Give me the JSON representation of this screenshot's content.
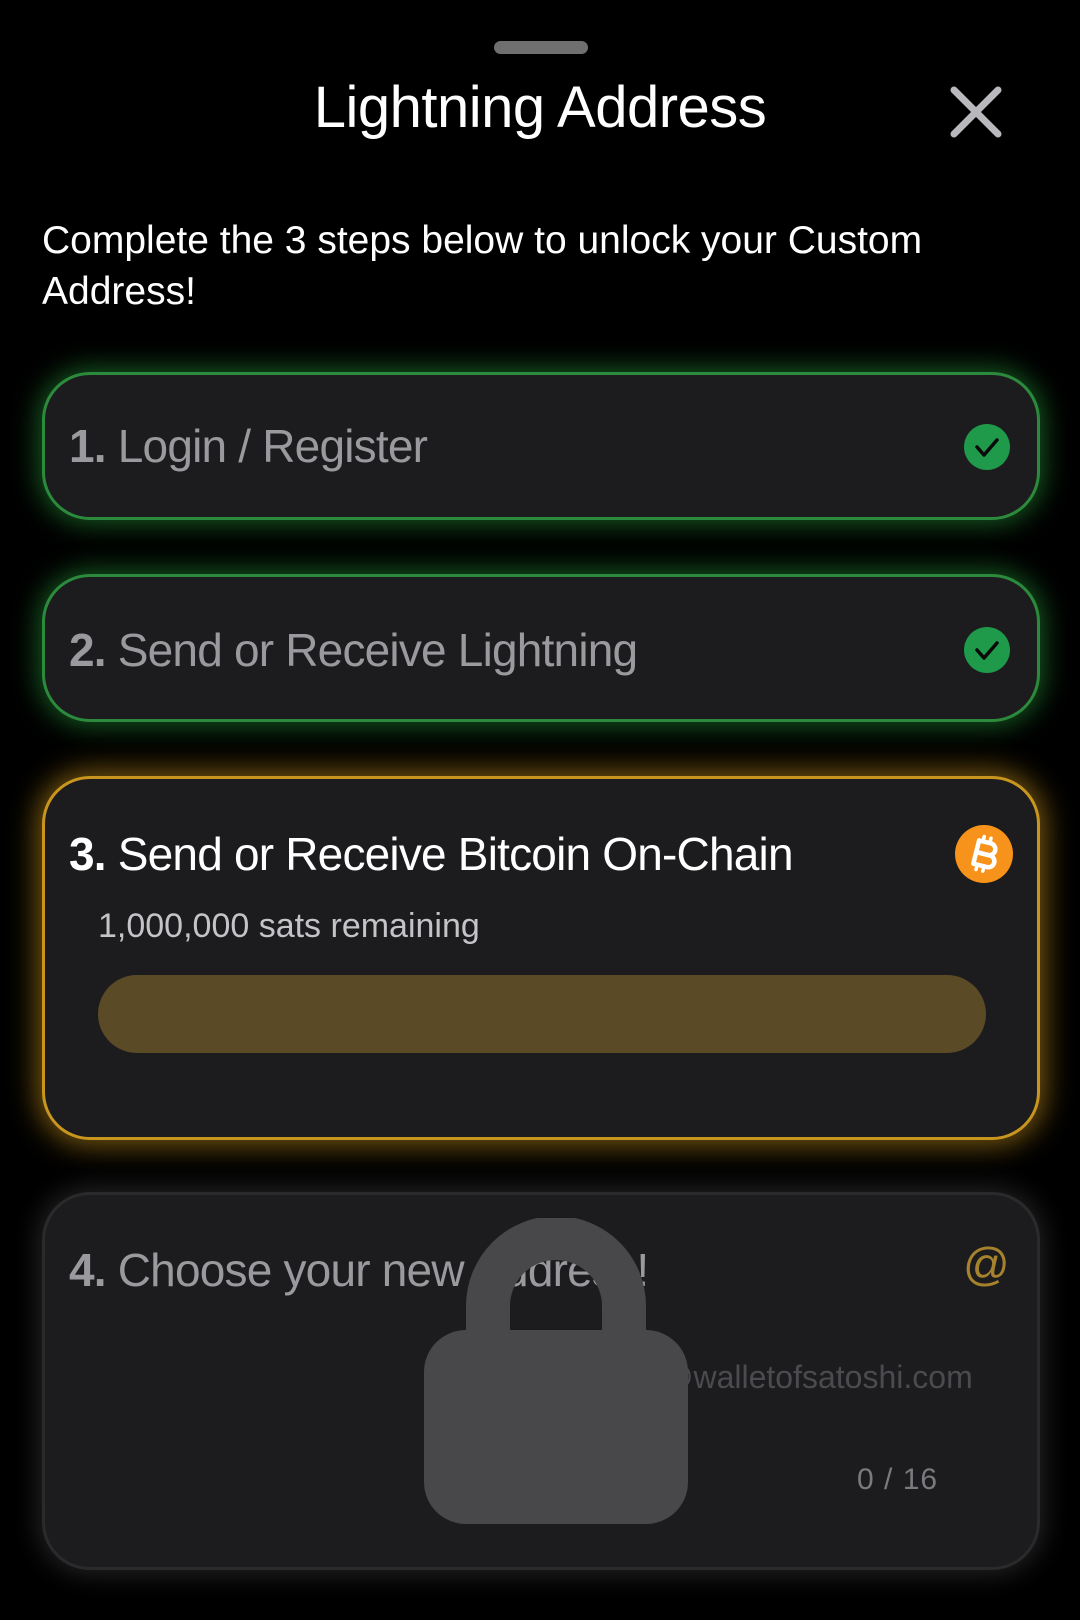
{
  "sheet": {
    "title": "Lightning Address",
    "intro": "Complete the 3 steps below to unlock your Custom Address!"
  },
  "steps": [
    {
      "number": "1.",
      "label": "Login / Register",
      "status": "done",
      "status_icon": "check-circle-icon"
    },
    {
      "number": "2.",
      "label": "Send or Receive Lightning",
      "status": "done",
      "status_icon": "check-circle-icon"
    },
    {
      "number": "3.",
      "label": "Send or Receive Bitcoin On-Chain",
      "status": "in-progress",
      "status_icon": "bitcoin-icon",
      "remaining": "1,000,000 sats remaining",
      "progress_percent": 0
    },
    {
      "number": "4.",
      "label": "Choose your new Address!",
      "status": "locked",
      "status_icon": "at-sign-icon",
      "at_symbol": "@",
      "domain": "@walletofsatoshi.com",
      "char_counter": "0 / 16"
    }
  ],
  "colors": {
    "background": "#000000",
    "card": "#1c1c1e",
    "success_green": "#1f9a4a",
    "glow_green": "#2c8a3c",
    "glow_yellow": "#c8951e",
    "bitcoin_orange": "#f7931a",
    "progress_track": "#5a4a26",
    "lock_grey": "#48484b"
  }
}
